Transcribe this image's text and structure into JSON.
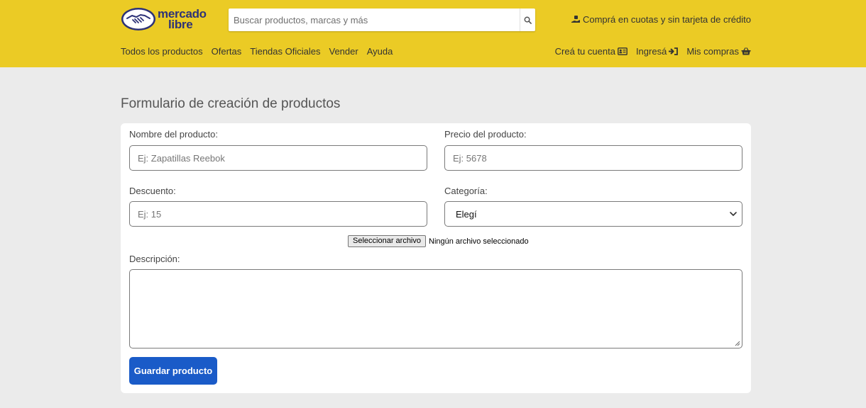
{
  "header": {
    "logo": {
      "line1": "mercado",
      "line2": "libre"
    },
    "search": {
      "placeholder": "Buscar productos, marcas y más"
    },
    "promo": "Comprá en cuotas y sin tarjeta de crédito",
    "nav_left": [
      "Todos los productos",
      "Ofertas",
      "Tiendas Oficiales",
      "Vender",
      "Ayuda"
    ],
    "nav_right": {
      "create_account": "Creá tu cuenta",
      "login": "Ingresá",
      "purchases": "Mis compras"
    }
  },
  "form": {
    "title": "Formulario de creación de productos",
    "name_label": "Nombre del producto:",
    "name_placeholder": "Ej: Zapatillas Reebok",
    "price_label": "Precio del producto:",
    "price_placeholder": "Ej: 5678",
    "discount_label": "Descuento:",
    "discount_placeholder": "Ej: 15",
    "category_label": "Categoría:",
    "category_selected": "Elegí",
    "file_button": "Seleccionar archivo",
    "file_status": "Ningún archivo seleccionado",
    "description_label": "Descripción:",
    "submit_label": "Guardar producto"
  },
  "colors": {
    "header_bg": "#ebcb25",
    "page_bg": "#ebebeb",
    "logo_text": "#2d3277",
    "primary_button": "#1a5bc8"
  },
  "icons": [
    "mercado-libre-handshake-icon",
    "search-icon",
    "hand-cash-icon",
    "id-card-icon",
    "sign-in-icon",
    "shopping-basket-icon",
    "chevron-down-icon",
    "resize-handle-icon"
  ]
}
